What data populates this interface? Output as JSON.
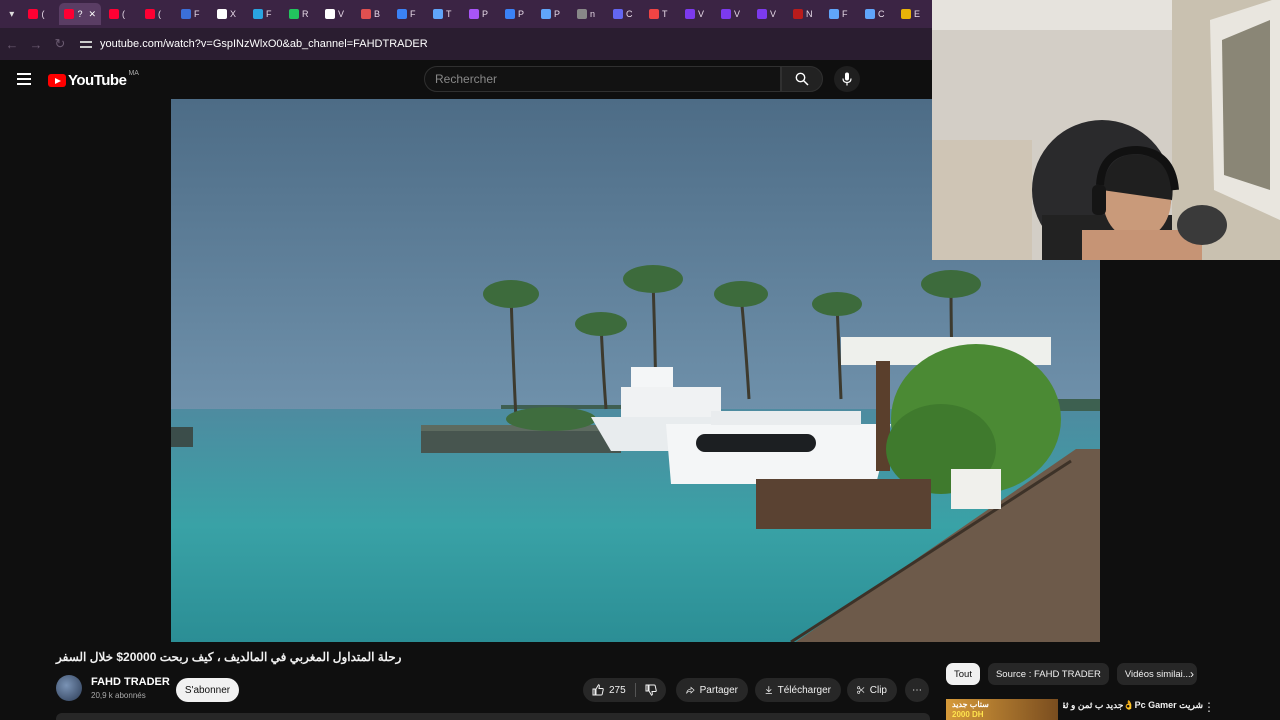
{
  "browser": {
    "tabs": [
      {
        "label": "(",
        "color": "#ff0033"
      },
      {
        "label": "?",
        "color": "#ff0033",
        "active": true
      },
      {
        "label": "(",
        "color": "#ff0033"
      },
      {
        "label": "(",
        "color": "#ff0033"
      },
      {
        "label": "F",
        "color": "#3b6fd9"
      },
      {
        "label": "X",
        "color": "#ffffff"
      },
      {
        "label": "F",
        "color": "#2aa4e0"
      },
      {
        "label": "R",
        "color": "#22c55e"
      },
      {
        "label": "V",
        "color": "#ffffff"
      },
      {
        "label": "B",
        "color": "#e05050"
      },
      {
        "label": "F",
        "color": "#3b82f6"
      },
      {
        "label": "T",
        "color": "#60a5fa"
      },
      {
        "label": "P",
        "color": "#a855f7"
      },
      {
        "label": "P",
        "color": "#3b82f6"
      },
      {
        "label": "P",
        "color": "#60a5fa"
      },
      {
        "label": "n",
        "color": "#888888"
      },
      {
        "label": "C",
        "color": "#6366f1"
      },
      {
        "label": "T",
        "color": "#ef4444"
      },
      {
        "label": "V",
        "color": "#7c3aed"
      },
      {
        "label": "V",
        "color": "#7c3aed"
      },
      {
        "label": "V",
        "color": "#7c3aed"
      },
      {
        "label": "N",
        "color": "#b91c1c"
      },
      {
        "label": "F",
        "color": "#60a5fa"
      },
      {
        "label": "C",
        "color": "#60a5fa"
      },
      {
        "label": "E",
        "color": "#eab308"
      }
    ],
    "close_glyph": "✕",
    "url": "youtube.com/watch?v=GspINzWlxO0&ab_channel=FAHDTRADER"
  },
  "header": {
    "logo_text": "YouTube",
    "country_code": "MA",
    "search_placeholder": "Rechercher"
  },
  "video": {
    "title": "رحلة المتداول المغربي في المالديف ، كيف ربحت 20000$ خلال السفر"
  },
  "channel": {
    "name": "FAHD TRADER",
    "subscribers": "20,9 k abonnés",
    "subscribe_label": "S'abonner"
  },
  "actions": {
    "likes": "275",
    "share_label": "Partager",
    "download_label": "Télécharger",
    "clip_label": "Clip",
    "more_glyph": "⋯"
  },
  "sidebar": {
    "chips": [
      "Tout",
      "Source : FAHD TRADER",
      "Vidéos similai..."
    ],
    "next_glyph": "›",
    "recommendation_title": "شريت Pc Gamer👌جديد ب ثمن و ثقة و",
    "recommendation_thumb_text": "ستاب جديد",
    "recommendation_price": "2000 DH"
  },
  "colors": {
    "brand_red": "#ff0000",
    "background": "#0f0f0f",
    "tab_strip": "#3b2444"
  }
}
